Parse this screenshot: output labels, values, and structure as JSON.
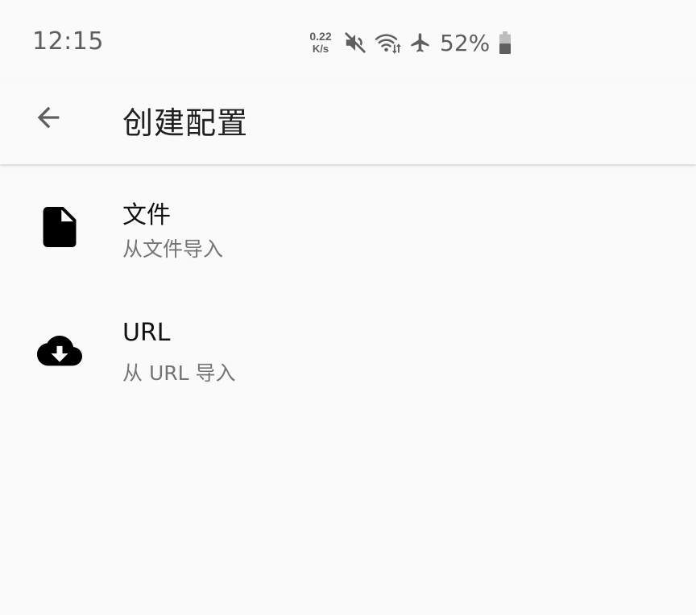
{
  "status_bar": {
    "time": "12:15",
    "net_speed_value": "0.22",
    "net_speed_unit": "K/s",
    "battery_percent": "52%",
    "icons": [
      "mute-icon",
      "wifi-icon",
      "airplane-mode-icon",
      "battery-icon"
    ]
  },
  "app_bar": {
    "title": "创建配置",
    "back_icon": "arrow-left-icon"
  },
  "options": [
    {
      "title": "文件",
      "subtitle": "从文件导入",
      "icon": "file-icon"
    },
    {
      "title": "URL",
      "subtitle": "从 URL 导入",
      "icon": "cloud-download-icon"
    }
  ],
  "colors": {
    "background": "#fafafa",
    "status_text": "#5f5f5f",
    "title_text": "#212121",
    "subtitle_text": "#757575",
    "icon": "#000000"
  }
}
